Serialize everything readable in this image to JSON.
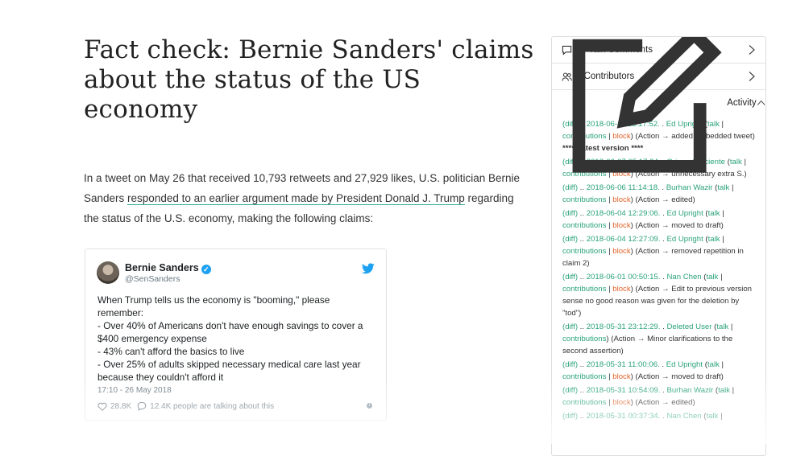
{
  "article": {
    "title": "Fact check: Bernie Sanders' claims about the status of the US economy",
    "intro_before": "In a tweet on May 26 that received 10,793 retweets and 27,929 likes, U.S. politician Bernie Sanders ",
    "intro_link": "responded to an earlier argument made by President Donald J. Trump",
    "intro_after": " regarding the status of the U.S. economy, making the following claims:"
  },
  "tweet": {
    "name": "Bernie Sanders",
    "handle": "@SenSanders",
    "text": "When Trump tells us the economy is \"booming,\" please remember:\n- Over 40% of Americans don't have enough savings to cover a $400 emergency expense\n- 43% can't afford the basics to live\n- Over 25% of adults skipped necessary medical care last year because they couldn't afford it",
    "time": "17:10 - 26 May 2018",
    "likes": "28.8K",
    "talking": "12.4K people are talking about this",
    "brand_color": "#1da1f2"
  },
  "panel": {
    "talk_label": "27 Talk Comments",
    "contributors_label": "9 Contributors",
    "activity_label": "Activity",
    "link_color": "#2aa37a",
    "block_color": "#e2622a",
    "entries": [
      {
        "diff": "(diff)",
        "time": "2018-06-11 15:17:52.",
        "user": "Ed Upright",
        "talk": "talk",
        "contribs": "contributions",
        "block": "block",
        "action": "(Action → added embedded tweet)",
        "extra": "**** Latest version ****"
      },
      {
        "diff": "(diff)",
        "time": "2018-06-07 05:17:24.",
        "user": "Oriana Carciente",
        "talk": "talk",
        "contribs": "contributions",
        "block": "block",
        "action": "(Action → unnecessary extra S.)",
        "extra": ""
      },
      {
        "diff": "(diff)",
        "time": "2018-06-06 11:14:18.",
        "user": "Burhan Wazir",
        "talk": "talk",
        "contribs": "contributions",
        "block": "block",
        "action": "(Action → edited)",
        "extra": ""
      },
      {
        "diff": "(diff)",
        "time": "2018-06-04 12:29:06.",
        "user": "Ed Upright",
        "talk": "talk",
        "contribs": "contributions",
        "block": "block",
        "action": "(Action → moved to draft)",
        "extra": ""
      },
      {
        "diff": "(diff)",
        "time": "2018-06-04 12:27:09.",
        "user": "Ed Upright",
        "talk": "talk",
        "contribs": "contributions",
        "block": "block",
        "action": "(Action → removed repetition in claim 2)",
        "extra": ""
      },
      {
        "diff": "(diff)",
        "time": "2018-06-01 00:50:15.",
        "user": "Nan Chen",
        "talk": "talk",
        "contribs": "contributions",
        "block": "block",
        "action": "(Action → Edit to previous version sense no good reason was given for the deletion by \"tod\")",
        "extra": ""
      },
      {
        "diff": "(diff)",
        "time": "2018-05-31 23:12:29.",
        "user": "Deleted User",
        "talk": "talk",
        "contribs": "contributions",
        "block": "",
        "action": "(Action → Minor clarifications to the second assertion)",
        "extra": ""
      },
      {
        "diff": "(diff)",
        "time": "2018-05-31 11:00:06.",
        "user": "Ed Upright",
        "talk": "talk",
        "contribs": "contributions",
        "block": "block",
        "action": "(Action → moved to draft)",
        "extra": ""
      },
      {
        "diff": "(diff)",
        "time": "2018-05-31 10:54:09.",
        "user": "Burhan Wazir",
        "talk": "talk",
        "contribs": "contributions",
        "block": "block",
        "action": "(Action → edited)",
        "extra": ""
      },
      {
        "diff": "(diff)",
        "time": "2018-05-31 00:37:34.",
        "user": "Nan Chen",
        "talk": "talk",
        "contribs": "",
        "block": "",
        "action": "",
        "extra": ""
      }
    ]
  }
}
